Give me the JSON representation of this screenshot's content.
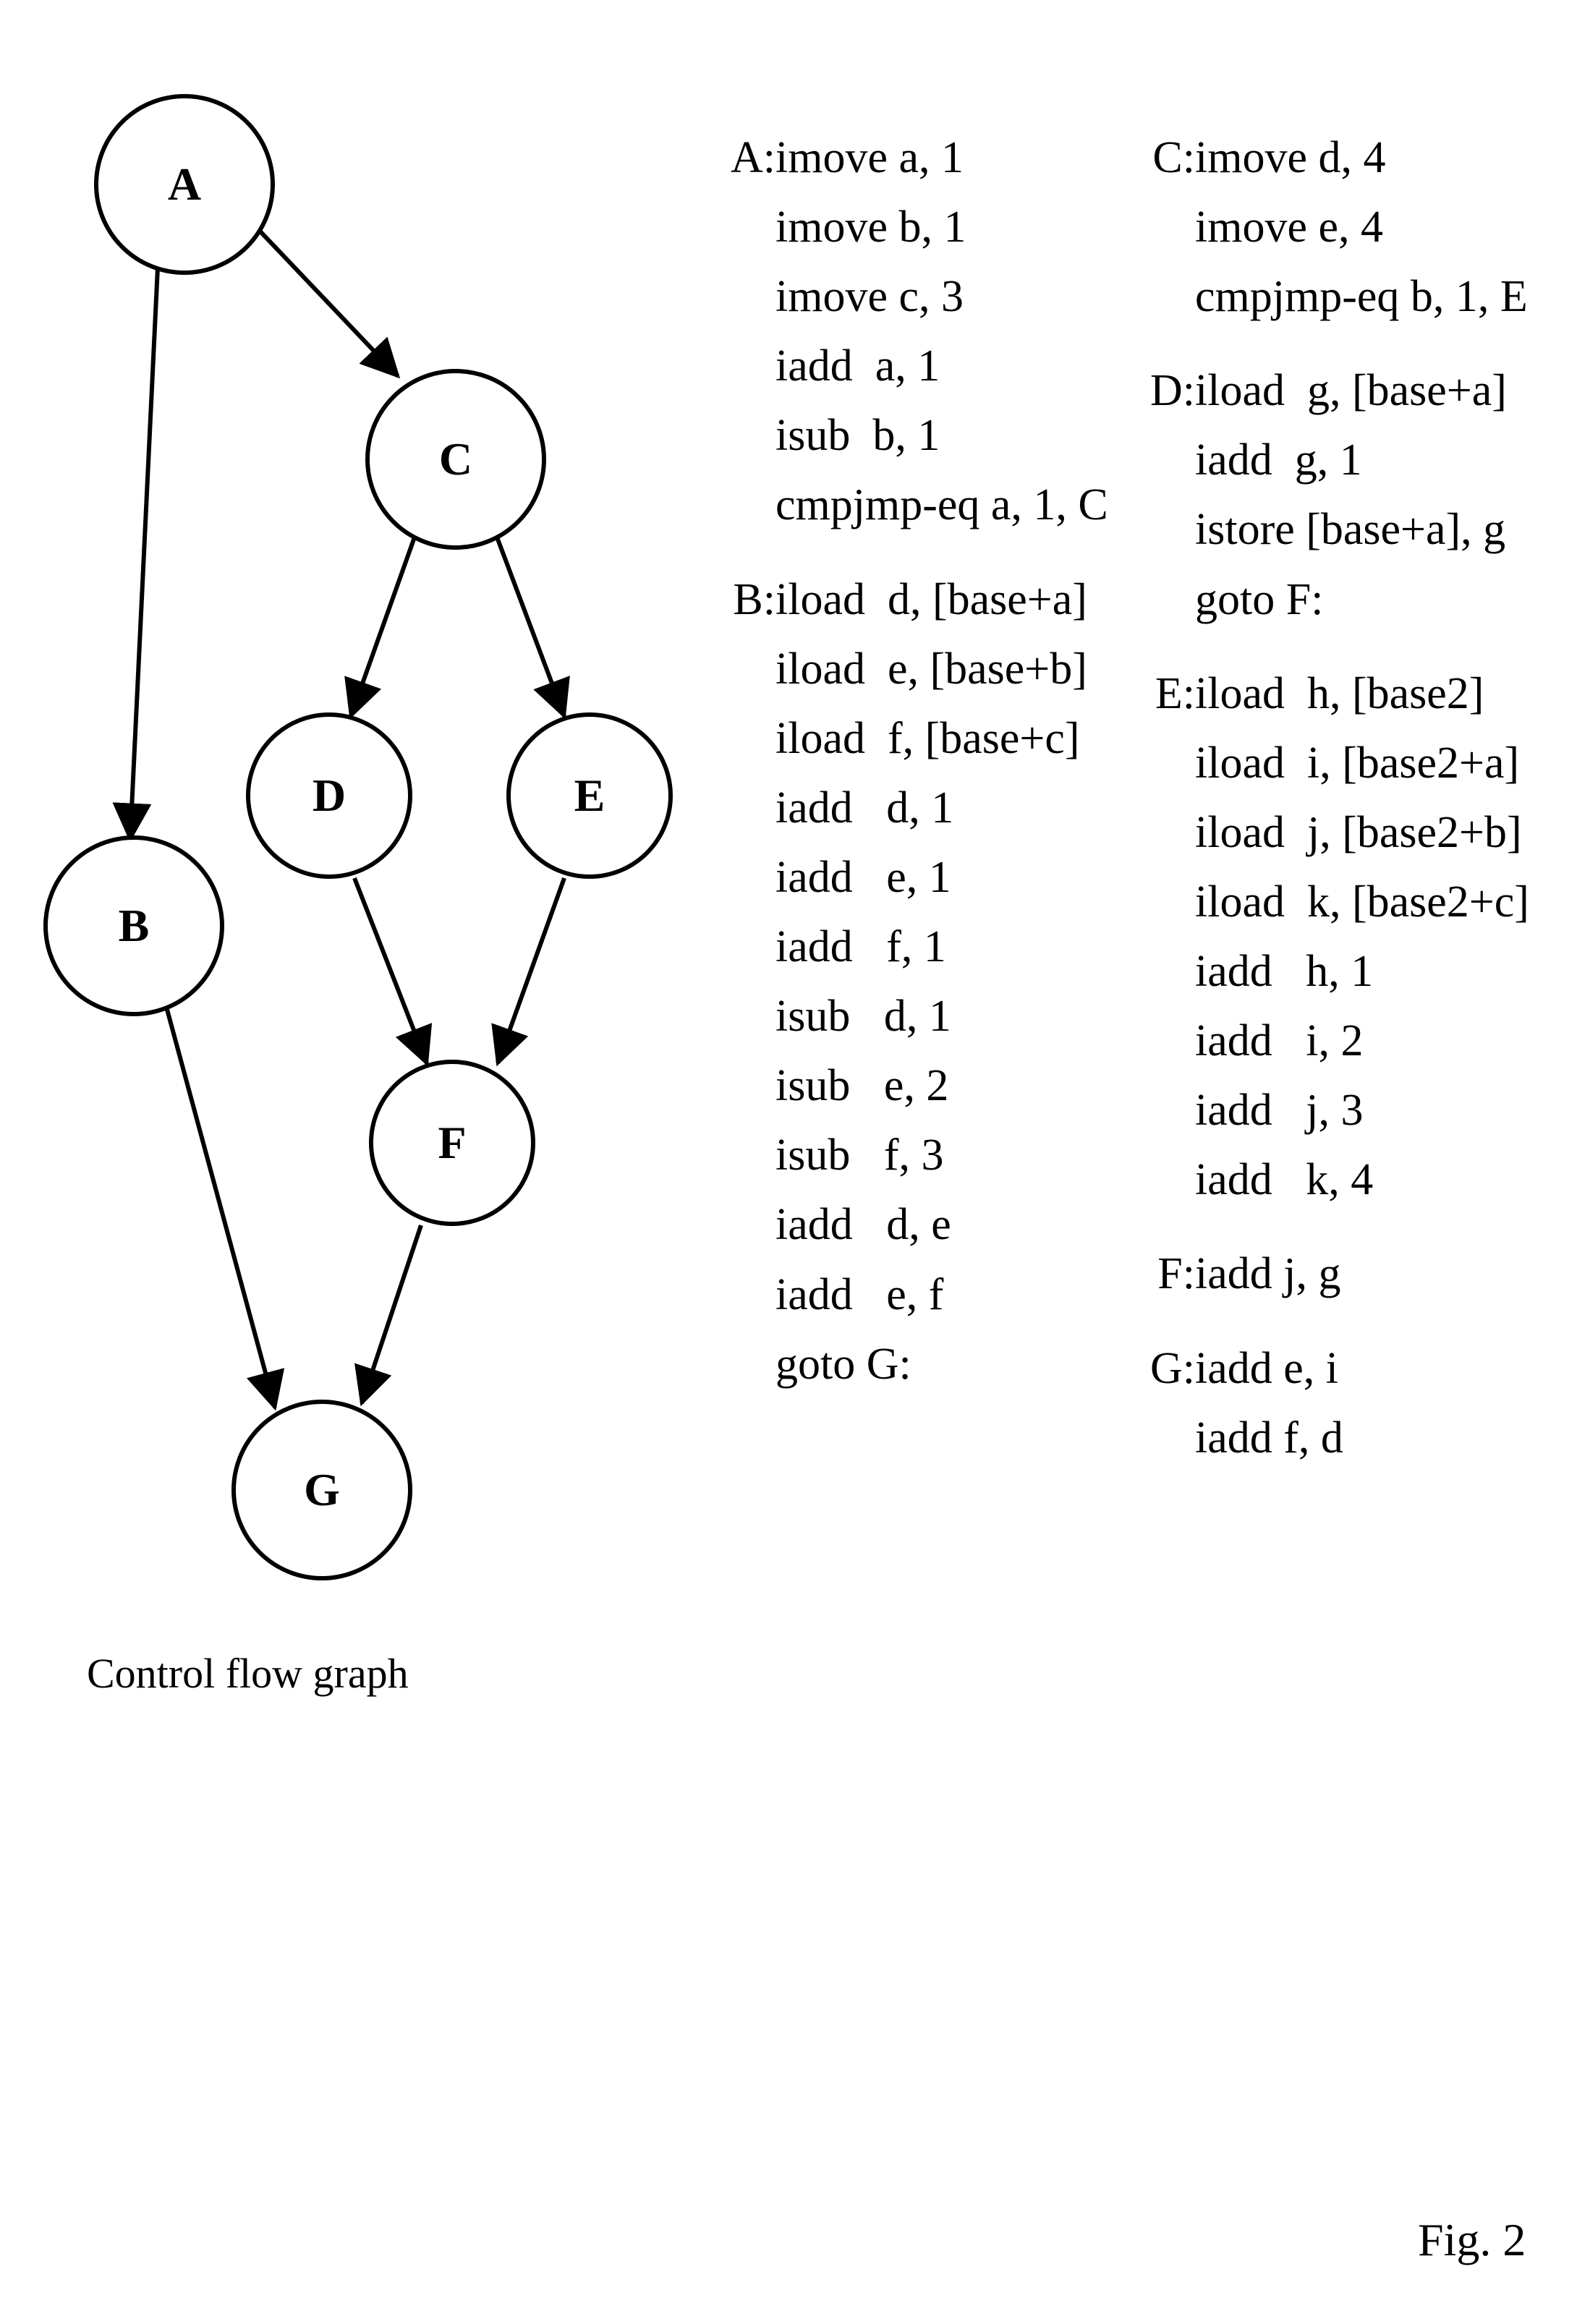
{
  "graph": {
    "caption": "Control flow graph",
    "nodes": {
      "A": "A",
      "B": "B",
      "C": "C",
      "D": "D",
      "E": "E",
      "F": "F",
      "G": "G"
    }
  },
  "figure_caption": "Fig. 2",
  "col1": {
    "A": [
      "imove a, 1",
      "imove b, 1",
      "imove c, 3",
      "iadd  a, 1",
      "isub  b, 1",
      "cmpjmp-eq a, 1, C"
    ],
    "B": [
      "iload  d, [base+a]",
      "iload  e, [base+b]",
      "iload  f, [base+c]",
      "iadd   d, 1",
      "iadd   e, 1",
      "iadd   f, 1",
      "isub   d, 1",
      "isub   e, 2",
      "isub   f, 3",
      "iadd   d, e",
      "iadd   e, f",
      "goto G:"
    ]
  },
  "col2": {
    "C": [
      "imove d, 4",
      "imove e, 4",
      "cmpjmp-eq b, 1, E"
    ],
    "D": [
      "iload  g, [base+a]",
      "iadd  g, 1",
      "istore [base+a], g",
      "goto F:"
    ],
    "E": [
      "iload  h, [base2]",
      "iload  i, [base2+a]",
      "iload  j, [base2+b]",
      "iload  k, [base2+c]",
      "iadd   h, 1",
      "iadd   i, 2",
      "iadd   j, 3",
      "iadd   k, 4"
    ],
    "F": [
      "iadd j, g"
    ],
    "G": [
      "iadd e, i",
      "iadd f, d"
    ]
  },
  "labels": {
    "A": "A:",
    "B": "B:",
    "C": "C:",
    "D": "D:",
    "E": "E:",
    "F": "F:",
    "G": "G:"
  }
}
